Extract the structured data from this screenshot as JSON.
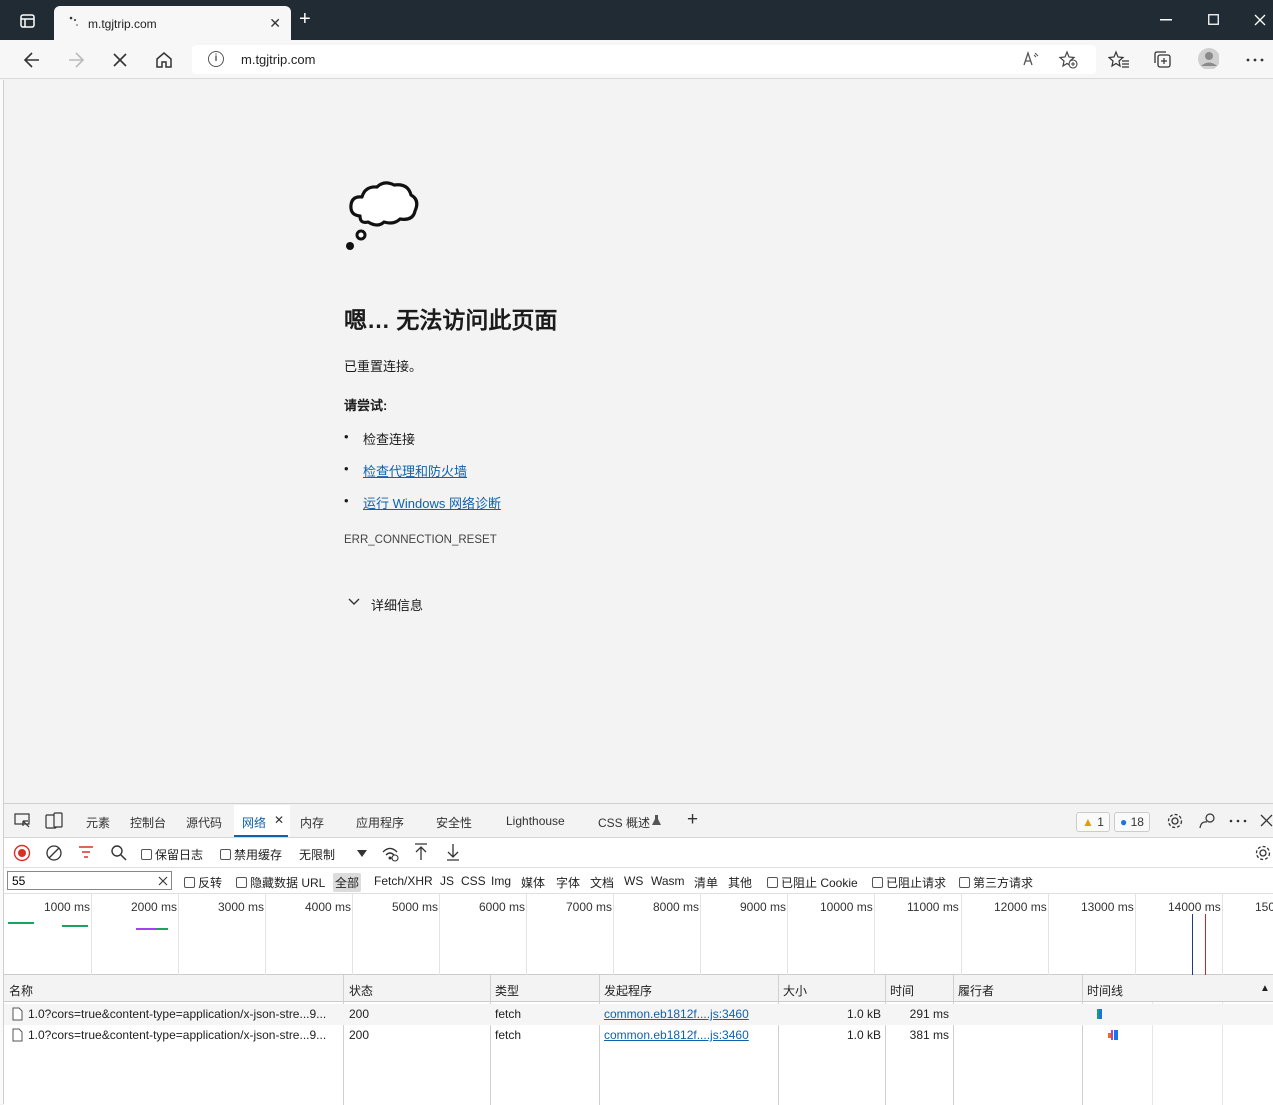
{
  "browser": {
    "tab_title": "m.tgjtrip.com",
    "tab_close": "✕",
    "new_tab": "+",
    "url": "m.tgjtrip.com"
  },
  "error_page": {
    "title": "嗯… 无法访问此页面",
    "subtitle": "已重置连接。",
    "try_label": "请尝试:",
    "suggestions": [
      {
        "text": "检查连接",
        "link": false
      },
      {
        "text": "检查代理和防火墙",
        "link": true
      },
      {
        "text": "运行 Windows 网络诊断",
        "link": true
      }
    ],
    "bullet": "•",
    "error_code": "ERR_CONNECTION_RESET",
    "details": "详细信息"
  },
  "devtools": {
    "tabs": [
      "元素",
      "控制台",
      "源代码",
      "网络",
      "内存",
      "应用程序",
      "安全性",
      "Lighthouse",
      "CSS 概述"
    ],
    "active_tab_close": "✕",
    "add_tab": "+",
    "warnings_count": "1",
    "messages_count": "18",
    "toolbar": {
      "preserve_log": "保留日志",
      "disable_cache": "禁用缓存",
      "throttling": "无限制"
    },
    "filter": {
      "value": "55",
      "invert": "反转",
      "hide_data_urls": "隐藏数据 URL",
      "types": [
        "全部",
        "Fetch/XHR",
        "JS",
        "CSS",
        "Img",
        "媒体",
        "字体",
        "文档",
        "WS",
        "Wasm",
        "清单",
        "其他"
      ],
      "selected_type": "全部",
      "blocked_cookies": "已阻止 Cookie",
      "blocked_requests": "已阻止请求",
      "third_party": "第三方请求"
    },
    "overview_ticks": [
      "1000 ms",
      "2000 ms",
      "3000 ms",
      "4000 ms",
      "5000 ms",
      "6000 ms",
      "7000 ms",
      "8000 ms",
      "9000 ms",
      "10000 ms",
      "11000 ms",
      "12000 ms",
      "13000 ms",
      "14000 ms",
      "150"
    ],
    "columns": [
      "名称",
      "状态",
      "类型",
      "发起程序",
      "大小",
      "时间",
      "履行者",
      "时间线"
    ],
    "sort_indicator": "▲",
    "rows": [
      {
        "name": "1.0?cors=true&content-type=application/x-json-stre...9...",
        "status": "200",
        "type": "fetch",
        "initiator": "common.eb1812f....js:3460",
        "size": "1.0 kB",
        "time": "291 ms"
      },
      {
        "name": "1.0?cors=true&content-type=application/x-json-stre...9...",
        "status": "200",
        "type": "fetch",
        "initiator": "common.eb1812f....js:3460",
        "size": "1.0 kB",
        "time": "381 ms"
      }
    ]
  }
}
